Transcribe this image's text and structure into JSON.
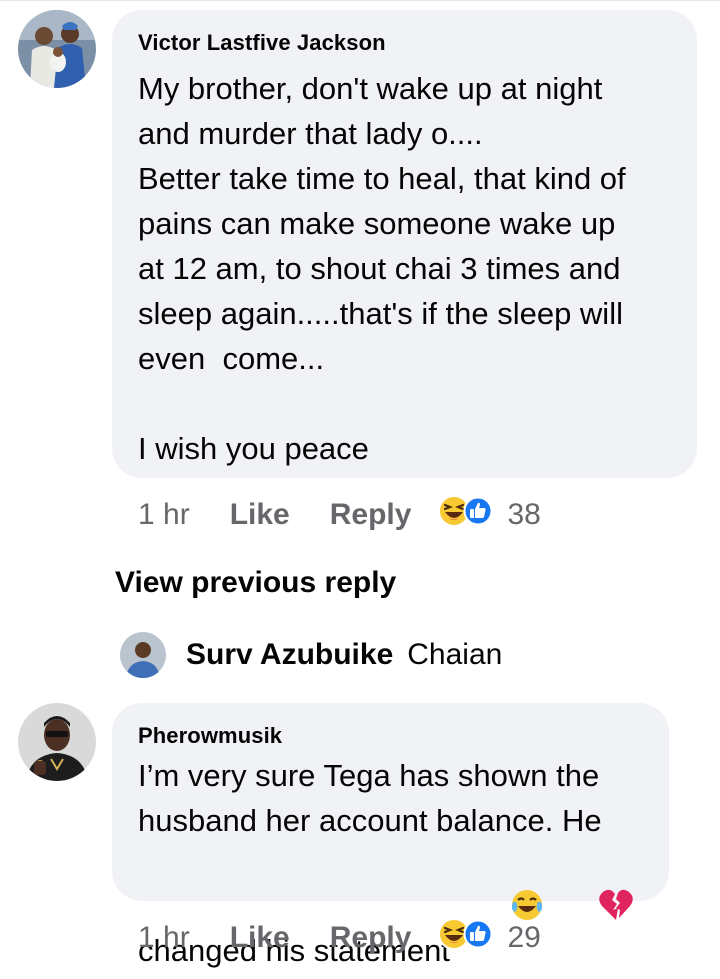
{
  "comments": [
    {
      "author": "Victor Lastfive Jackson",
      "text": "My brother, don't wake up at night\nand murder that lady o....\nBetter take time to heal, that kind of\npains can make someone wake up\nat 12 am, to shout chai 3 times and\nsleep again.....that's if the sleep will\neven  come...\n\nI wish you peace",
      "time": "1 hr",
      "like_label": "Like",
      "reply_label": "Reply",
      "reaction_icons": [
        "haha-emoji-icon",
        "like-thumb-icon"
      ],
      "reaction_count": "38"
    },
    {
      "author": "Pherowmusik",
      "text": "I’m very sure Tega has shown the\nhusband her account balance. He\nchanged his statement",
      "text_emojis": [
        "tears-of-joy-emoji-icon",
        "broken-heart-emoji-icon"
      ],
      "time": "1 hr",
      "like_label": "Like",
      "reply_label": "Reply",
      "reaction_icons": [
        "haha-emoji-icon",
        "like-thumb-icon"
      ],
      "reaction_count": "29"
    }
  ],
  "view_previous": "View previous reply",
  "reply_preview": {
    "author": "Surv Azubuike",
    "text": "Chaian"
  },
  "colors": {
    "bubble": "#f0f2f5",
    "meta": "#65676b",
    "like_blue": "#1877f2",
    "emoji_yellow": "#f7c933"
  }
}
